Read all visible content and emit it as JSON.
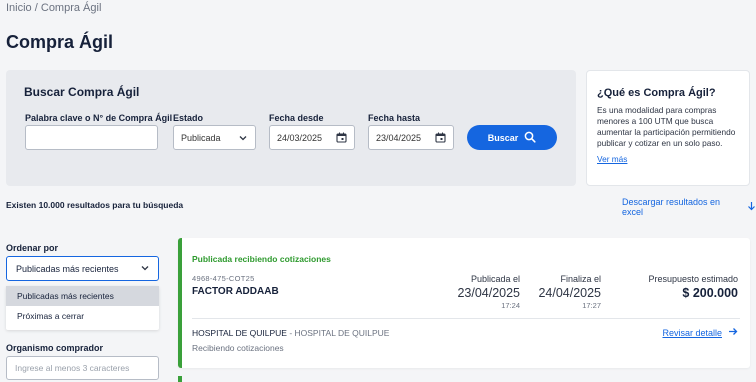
{
  "breadcrumb": {
    "home": "Inicio",
    "separator": "/",
    "current": "Compra Ágil"
  },
  "page_title": "Compra Ágil",
  "search": {
    "title": "Buscar Compra Ágil",
    "keyword_label": "Palabra clave o N° de Compra Ágil",
    "keyword_value": "",
    "estado_label": "Estado",
    "estado_value": "Publicada",
    "fecha_desde_label": "Fecha desde",
    "fecha_desde_value": "24/03/2025",
    "fecha_hasta_label": "Fecha hasta",
    "fecha_hasta_value": "23/04/2025",
    "button_label": "Buscar"
  },
  "info": {
    "title": "¿Qué es Compra Ágil?",
    "description": "Es una modalidad para compras menores a 100 UTM que busca aumentar la participación permitiendo publicar y cotizar en un solo paso.",
    "link": "Ver más"
  },
  "results": {
    "count_text": "Existen 10.000 resultados para tu búsqueda",
    "download_label": "Descargar resultados en excel"
  },
  "sort": {
    "label": "Ordenar por",
    "value": "Publicadas más recientes",
    "options": [
      "Publicadas más recientes",
      "Próximas a cerrar"
    ]
  },
  "organismo": {
    "label": "Organismo comprador",
    "placeholder": "Ingrese al menos 3 caracteres"
  },
  "card": {
    "status": "Publicada recibiendo cotizaciones",
    "code": "4968-475-COT25",
    "name": "FACTOR ADDAAB",
    "published_label": "Publicada el",
    "published_date": "23/04/2025",
    "published_time": "17:24",
    "closes_label": "Finaliza el",
    "closes_date": "24/04/2025",
    "closes_time": "17:27",
    "budget_label": "Presupuesto estimado",
    "budget_value": "$ 200.000",
    "org_name": "HOSPITAL DE QUILPUE",
    "org_sep": " - ",
    "org_unit": "HOSPITAL DE QUILPUE",
    "sub_status": "Recibiendo cotizaciones",
    "detail_link": "Revisar detalle"
  },
  "colors": {
    "primary": "#1566e0",
    "status_green": "#2e9a2e"
  }
}
